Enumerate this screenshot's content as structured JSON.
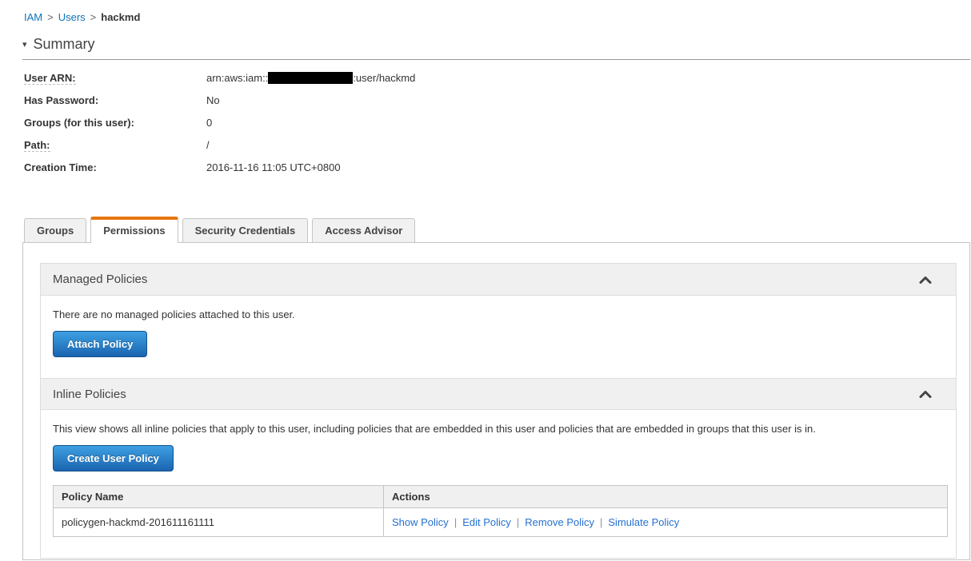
{
  "breadcrumb": {
    "separator": ">",
    "items": [
      {
        "label": "IAM"
      },
      {
        "label": "Users"
      }
    ],
    "current": "hackmd"
  },
  "summary": {
    "title": "Summary",
    "caret_icon": "▾",
    "rows": {
      "user_arn": {
        "label": "User ARN:",
        "value_prefix": "arn:aws:iam::",
        "value_redacted": true,
        "value_suffix": ":user/hackmd"
      },
      "has_password": {
        "label": "Has Password:",
        "value": "No"
      },
      "groups": {
        "label": "Groups (for this user):",
        "value": "0"
      },
      "path": {
        "label": "Path:",
        "value": "/"
      },
      "creation_time": {
        "label": "Creation Time:",
        "value": "2016-11-16 11:05 UTC+0800"
      }
    }
  },
  "tabs": [
    {
      "label": "Groups",
      "active": false
    },
    {
      "label": "Permissions",
      "active": true
    },
    {
      "label": "Security Credentials",
      "active": false
    },
    {
      "label": "Access Advisor",
      "active": false
    }
  ],
  "managed_policies": {
    "title": "Managed Policies",
    "empty_message": "There are no managed policies attached to this user.",
    "attach_button": "Attach Policy",
    "collapse_state": "expanded"
  },
  "inline_policies": {
    "title": "Inline Policies",
    "description": "This view shows all inline policies that apply to this user, including policies that are embedded in this user and policies that are embedded in groups that this user is in.",
    "create_button": "Create User Policy",
    "collapse_state": "expanded",
    "table": {
      "headers": [
        "Policy Name",
        "Actions"
      ],
      "action_separator": "|",
      "rows": [
        {
          "policy_name": "policygen-hackmd-201611161111",
          "actions": [
            "Show Policy",
            "Edit Policy",
            "Remove Policy",
            "Simulate Policy"
          ]
        }
      ]
    }
  },
  "colors": {
    "accent_orange": "#e87511",
    "breadcrumb_link_blue": "#0d74b8",
    "action_link_blue": "#2570cf",
    "button_blue_top": "#3ea0e2",
    "button_blue_bottom": "#1a64b0",
    "section_header_bg": "#f0f0f0",
    "panel_border": "#c5c5c5",
    "redaction": "#000000"
  }
}
